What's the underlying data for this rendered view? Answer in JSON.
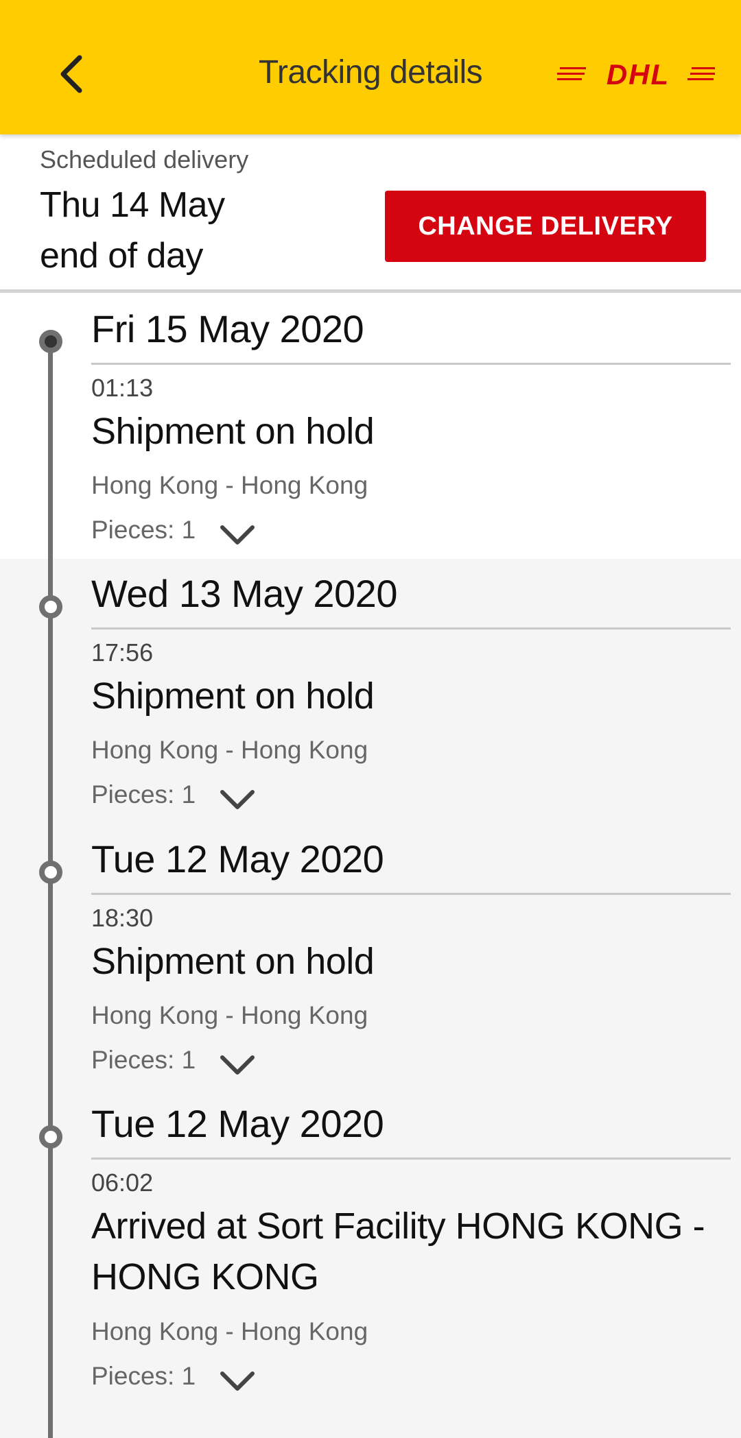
{
  "header": {
    "title": "Tracking details",
    "logo_text": "DHL",
    "back_icon": "chevron-left-icon"
  },
  "delivery": {
    "label": "Scheduled delivery",
    "date_line1": "Thu 14 May",
    "date_line2": "end of day",
    "change_button": "CHANGE DELIVERY"
  },
  "colors": {
    "brand_yellow": "#ffcc00",
    "brand_red": "#d40511"
  },
  "events": [
    {
      "date": "Fri 15 May 2020",
      "time": "01:13",
      "status": "Shipment on hold",
      "location": "Hong Kong - Hong Kong",
      "pieces": "Pieces: 1"
    },
    {
      "date": "Wed 13 May 2020",
      "time": "17:56",
      "status": "Shipment on hold",
      "location": "Hong Kong - Hong Kong",
      "pieces": "Pieces: 1"
    },
    {
      "date": "Tue 12 May 2020",
      "time": "18:30",
      "status": "Shipment on hold",
      "location": "Hong Kong - Hong Kong",
      "pieces": "Pieces: 1"
    },
    {
      "date": "Tue 12 May 2020",
      "time": "06:02",
      "status_line1": "Arrived at Sort Facility HONG KONG -",
      "status_line2": "HONG KONG",
      "location": "Hong Kong - Hong Kong",
      "pieces": "Pieces: 1"
    }
  ]
}
